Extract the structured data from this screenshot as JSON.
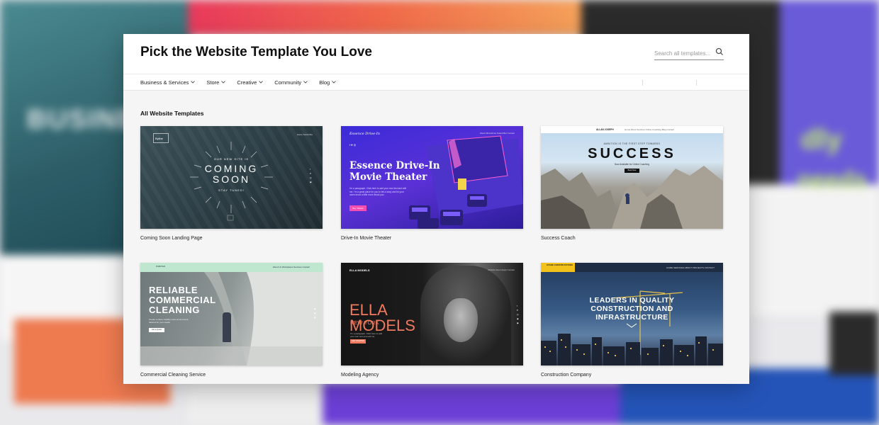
{
  "backdrop": {
    "left_text": "BUSINE",
    "right_text_1": "dly",
    "right_text_2": "needs"
  },
  "modal": {
    "title": "Pick the Website Template You Love",
    "search": {
      "placeholder": "Search all templates..."
    },
    "nav": [
      {
        "label": "Business & Services"
      },
      {
        "label": "Store"
      },
      {
        "label": "Creative"
      },
      {
        "label": "Community"
      },
      {
        "label": "Blog"
      }
    ],
    "section_title": "All Website Templates",
    "templates": [
      {
        "label": "Coming Soon Landing Page",
        "thumb": {
          "logo": "Byline",
          "menu": "Home   Subscribe",
          "small_top": "OUR NEW SITE IS",
          "big_1": "COMING",
          "big_2": "SOON",
          "small_bottom": "STAY TUNED!"
        }
      },
      {
        "label": "Drive-In Movie Theater",
        "thumb": {
          "brand": "Essence Drive-In",
          "menu": "About   Showtimes   Snack Bar   Contact",
          "hero_1": "Essence Drive-In",
          "hero_2": "Movie Theater",
          "para": "I'm a paragraph. Click here to add your own text and edit me. I'm a great place for you to tell a story and let your users know a little more about you.",
          "button": "Buy Tickets",
          "social": "f  ♥  ◎"
        }
      },
      {
        "label": "Success Coach",
        "thumb": {
          "brand": "ALLAN JOSEPH",
          "menu": "Home   About   Services   Online Coaching   Blog   Contact",
          "sub": "AMBITION IS THE FIRST STEP TOWARDS",
          "hero": "SUCCESS",
          "sub2": "Now Available for Online Coaching",
          "button": "Book Now"
        }
      },
      {
        "label": "Commercial Cleaning Service",
        "thumb": {
          "brand": "PURITAN",
          "menu": "About Us   Workplaces   Services   Contact",
          "hero_1": "RELIABLE",
          "hero_2": "COMMERCIAL",
          "hero_3": "CLEANING",
          "para": "Create a clean, healthy work environment tailored for your needs",
          "button": "Get a Quote"
        }
      },
      {
        "label": "Modeling Agency",
        "thumb": {
          "brand": "ELLA MODELS",
          "menu": "Models   About   Apply   Contact",
          "hero_1": "ELLA",
          "hero_2": "MODELS",
          "city": "NEW YORK",
          "para": "I'm a paragraph. Click here to add your own text and edit me.",
          "button": "GET STARTED"
        }
      },
      {
        "label": "Construction Company",
        "thumb": {
          "logo": "STADE CONSTRUCTIONS",
          "menu": "HOME   SERVICES   ABOUT   PROJECTS   CONTACT",
          "hero_1": "LEADERS IN QUALITY",
          "hero_2": "CONSTRUCTION AND",
          "hero_3": "INFRASTRUCTURE"
        }
      }
    ]
  },
  "colors": {
    "accent_pink": "#f44eb0",
    "coral": "#f07a5f",
    "construction_yellow": "#f3c21a",
    "cleaning_mint": "#bfe7cf"
  }
}
